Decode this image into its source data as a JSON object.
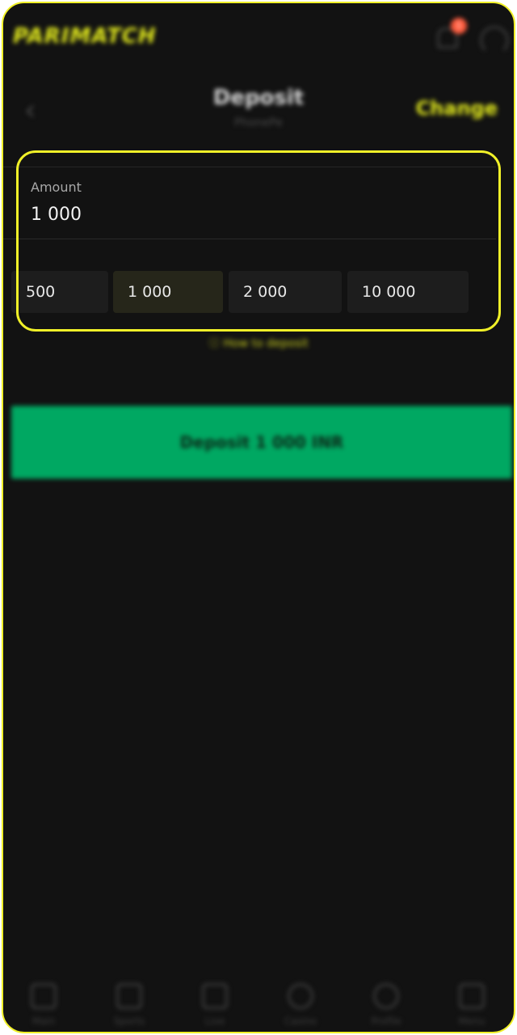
{
  "header": {
    "logo": "PARIMATCH",
    "notification_count": "1"
  },
  "titlebar": {
    "title": "Deposit",
    "subtitle": "PhonePe",
    "change_label": "Change"
  },
  "amount": {
    "label": "Amount",
    "value": "1 000"
  },
  "quick_amounts": [
    {
      "label": "500",
      "selected": false
    },
    {
      "label": "1 000",
      "selected": true
    },
    {
      "label": "2 000",
      "selected": false
    },
    {
      "label": "10 000",
      "selected": false
    }
  ],
  "how_to_label": "How to deposit",
  "deposit_button_label": "Deposit 1 000 INR",
  "bottom_nav": [
    {
      "label": "Main"
    },
    {
      "label": "Sports"
    },
    {
      "label": "Live"
    },
    {
      "label": "Casino"
    },
    {
      "label": "Profile"
    },
    {
      "label": "Menu"
    }
  ],
  "colors": {
    "accent": "#f0f028",
    "button": "#00a862",
    "background": "#121212"
  }
}
